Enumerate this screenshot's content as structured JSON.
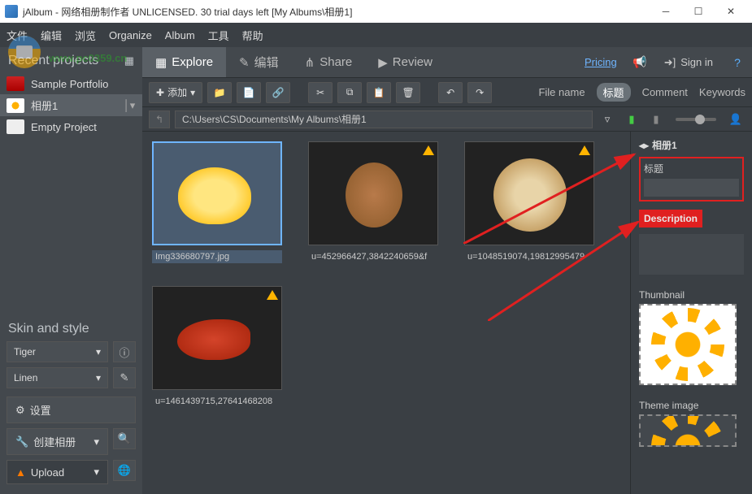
{
  "window": {
    "title": "jAlbum - 网络相册制作者 UNLICENSED. 30 trial days left [My Albums\\相册1]"
  },
  "menu": {
    "file": "文件",
    "edit": "编辑",
    "view": "浏览",
    "organize": "Organize",
    "album": "Album",
    "tools": "工具",
    "help": "帮助"
  },
  "watermark_url": "www.pc0359.cn",
  "sidebar": {
    "recent_header": "Recent projects",
    "projects": [
      {
        "label": "Sample Portfolio"
      },
      {
        "label": "相册1"
      },
      {
        "label": "Empty Project"
      }
    ],
    "skin_header": "Skin and style",
    "skin": "Tiger",
    "style": "Linen",
    "settings": "设置",
    "create": "创建相册",
    "upload": "Upload"
  },
  "tabs": {
    "explore": "Explore",
    "edit": "编辑",
    "share": "Share",
    "review": "Review",
    "pricing": "Pricing",
    "signin": "Sign in"
  },
  "toolbar": {
    "add": "添加"
  },
  "columns": {
    "filename": "File name",
    "title": "标题",
    "comment": "Comment",
    "keywords": "Keywords"
  },
  "path": "C:\\Users\\CS\\Documents\\My Albums\\相册1",
  "items": [
    {
      "caption": "Img336680797.jpg",
      "warn": false,
      "cls": "duck",
      "sel": true
    },
    {
      "caption": "u=452966427,3842240659&f",
      "warn": true,
      "cls": "squirrel"
    },
    {
      "caption": "u=1048519074,19812995479",
      "warn": true,
      "cls": "cheetah"
    },
    {
      "caption": "u=1461439715,27641468208",
      "warn": true,
      "cls": "pheasant"
    }
  ],
  "panel": {
    "title": "相册1",
    "title_label": "标题",
    "desc_label": "Description",
    "thumb_label": "Thumbnail",
    "theme_label": "Theme image"
  }
}
